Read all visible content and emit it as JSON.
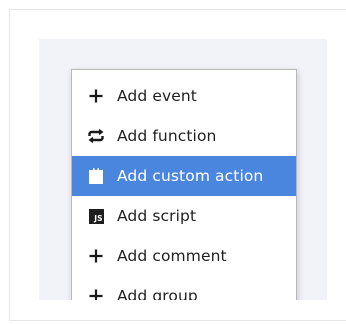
{
  "menu": {
    "items": [
      {
        "label": "Add event",
        "icon": "plus-icon"
      },
      {
        "label": "Add function",
        "icon": "repeat-arrows-icon"
      },
      {
        "label": "Add custom action",
        "icon": "puzzle-piece-icon",
        "highlighted": true
      },
      {
        "label": "Add script",
        "icon": "js-icon",
        "icon_text": "JS"
      },
      {
        "label": "Add comment",
        "icon": "plus-icon"
      },
      {
        "label": "Add group",
        "icon": "plus-icon"
      }
    ]
  },
  "colors": {
    "panel_background": "#f2f3f9",
    "highlight": "#4a86de",
    "text": "#1f1f1f"
  }
}
